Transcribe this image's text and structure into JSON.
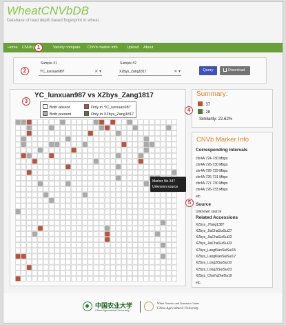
{
  "header": {
    "title": "WheatCNVbDB",
    "subtitle": "Database of read depth based fingerprint in wheat."
  },
  "nav": {
    "items": [
      "Home",
      "CNVb pr",
      "Variety compare",
      "CNVb marker info",
      "Upload",
      "About"
    ]
  },
  "callouts": [
    "1",
    "2",
    "3",
    "4",
    "5"
  ],
  "compare": {
    "sample1_label": "Sample #1",
    "sample1_value": "YC_lunxuan987",
    "sample2_label": "Sample #2",
    "sample2_value": "XZbys_Zang1817",
    "clear_glyph": "✕",
    "arrow_glyph": "▾",
    "query_label": "Query",
    "download_label": "Download"
  },
  "fingerprint": {
    "title": "YC_lunxuan987 vs XZbys_Zang1817",
    "legend": {
      "both_absent": "Both absent",
      "both_present": "Both present",
      "only_s1": "Only in YC_lunxuan987",
      "only_s2": "Only in XZbys_Zang1817"
    },
    "colors": {
      "absent": "#ffffff",
      "present": "#a9a9a9",
      "only_s1": "#b5533c",
      "only_s2": "#4d7a3a"
    },
    "tooltip_line1": "Marker No.347",
    "tooltip_line2": "Unknown source",
    "grid_rows": [
      "GGRAAAAAGAAAAAGRARAAGAAAAAAAA",
      "AAGAAAGAAAAAAAAGRAAAAGAAAAAGA",
      "AARAAAAAAAAAARAAAAGAAAAAAAAAA",
      "AGAAAAAAAGAAAAAAAAAAAAAGAAAAA",
      "AGAAAAGGAAAAGAAAAAARAAAGGAAAA",
      "AAAAGAAAAARAAAAAAAAAAAAGAAAAA",
      "ARGAAARAAAAAAAAAAAGAAAGAAAAAA",
      "AAARAAAAAAAAAAGAAAAAAARAAAAAA",
      "AAAAAAAAARAAAAAAAAGAAAAAAAAAA",
      "AARAAAAAAAAAAAAAAAAAAAAAAAAAG",
      "AAAAAAAAAAAAAAAAAAGAAAAAGGAAA",
      "AAAAGAAAAGAAAAAAAAAAAAAGAARAA",
      "AAAAAAAAAAAAAAAAAAAAAAAAAAAAA",
      "AAAAAGAAAAAAGAAAAAAAAAAAAAAAA",
      "AAAAAAGAAAAAAAAAAAAAAAAAAAAAA",
      "AAAAAAAAAAAAAAAAAAAAAAAAAAAAA",
      "GAAAAAAAAAAAAAAAAAAAAAAAAAAAA",
      "AAAAAAAAAAAAAAAAAAAAAAAAAAAAA",
      "AAAAAAAAAAAAAAAAAAAAAAAAAAGAA",
      "AAAARAAAAAAAAAAAGAAAAAAAAAAAA",
      "AAAGAAAAAAAAAAAARAAAAAAAAGAAA",
      "AAAAAAAAAAAAAAAARAAAAAAAAAAAA",
      "AAAAAAAAAAAAAAAAAAAAAAAAAAGAA",
      "AAAAAAAAAAAAAAAAAAAAAAAAAAAAA",
      "RRAAAAAAAAAAAAAAAAAAAAAAAAGAA",
      "AAAAAAAAAAAAAAAAAAAAAAAAAAAAA",
      "AARAAAAAAAAAAAAAAAAAAAAAAAAAA",
      "AAAAAAAAAAAAAAAAAAAAAAAAAAAAA",
      "RAAAAAAAAAAAAAAAAAAAAAAAAAAAA"
    ]
  },
  "summary": {
    "title": "Summary:",
    "only_s1_count": ": 37",
    "only_s2_count": ": 28",
    "similarity": "Similarity: 22.62%"
  },
  "marker_info": {
    "title": "CNVb Marker Info",
    "intervals_heading": "Corresponding Intervals",
    "intervals": [
      "chr4A:724-730 Mbps",
      "chr4A:726-730 Mbps",
      "chr4A:726-729 Mbps",
      "chr4A:726-731 Mbps",
      "chr4A:727-730 Mbps",
      "chr4A:726-733 Mbps",
      "etc."
    ],
    "source_heading": "Source",
    "source_value": "Unknown source",
    "accessions_heading": "Related Accessions",
    "accessions": [
      "XZbys_JTang1387",
      "XZbys_JiaChaSuiSui27",
      "XZbys_JiaChaSuiSui32",
      "XZbys_JiaChaSuiSui33",
      "XZbys_LangKianSuiSui15",
      "XZbys_LangKianSuiSui17",
      "XZbys_LongZiSuiSui10",
      "XZbys_LongZiSuiSui23",
      "XZbys_ChaYaZheDa19",
      "etc."
    ]
  },
  "footer": {
    "cau_cn": "中国农业大学",
    "cau_en": "China Agricultural University",
    "wgc_line1": "Wheat Genetics and Genomics Center",
    "wgc_line2": "China Agricultural University"
  }
}
